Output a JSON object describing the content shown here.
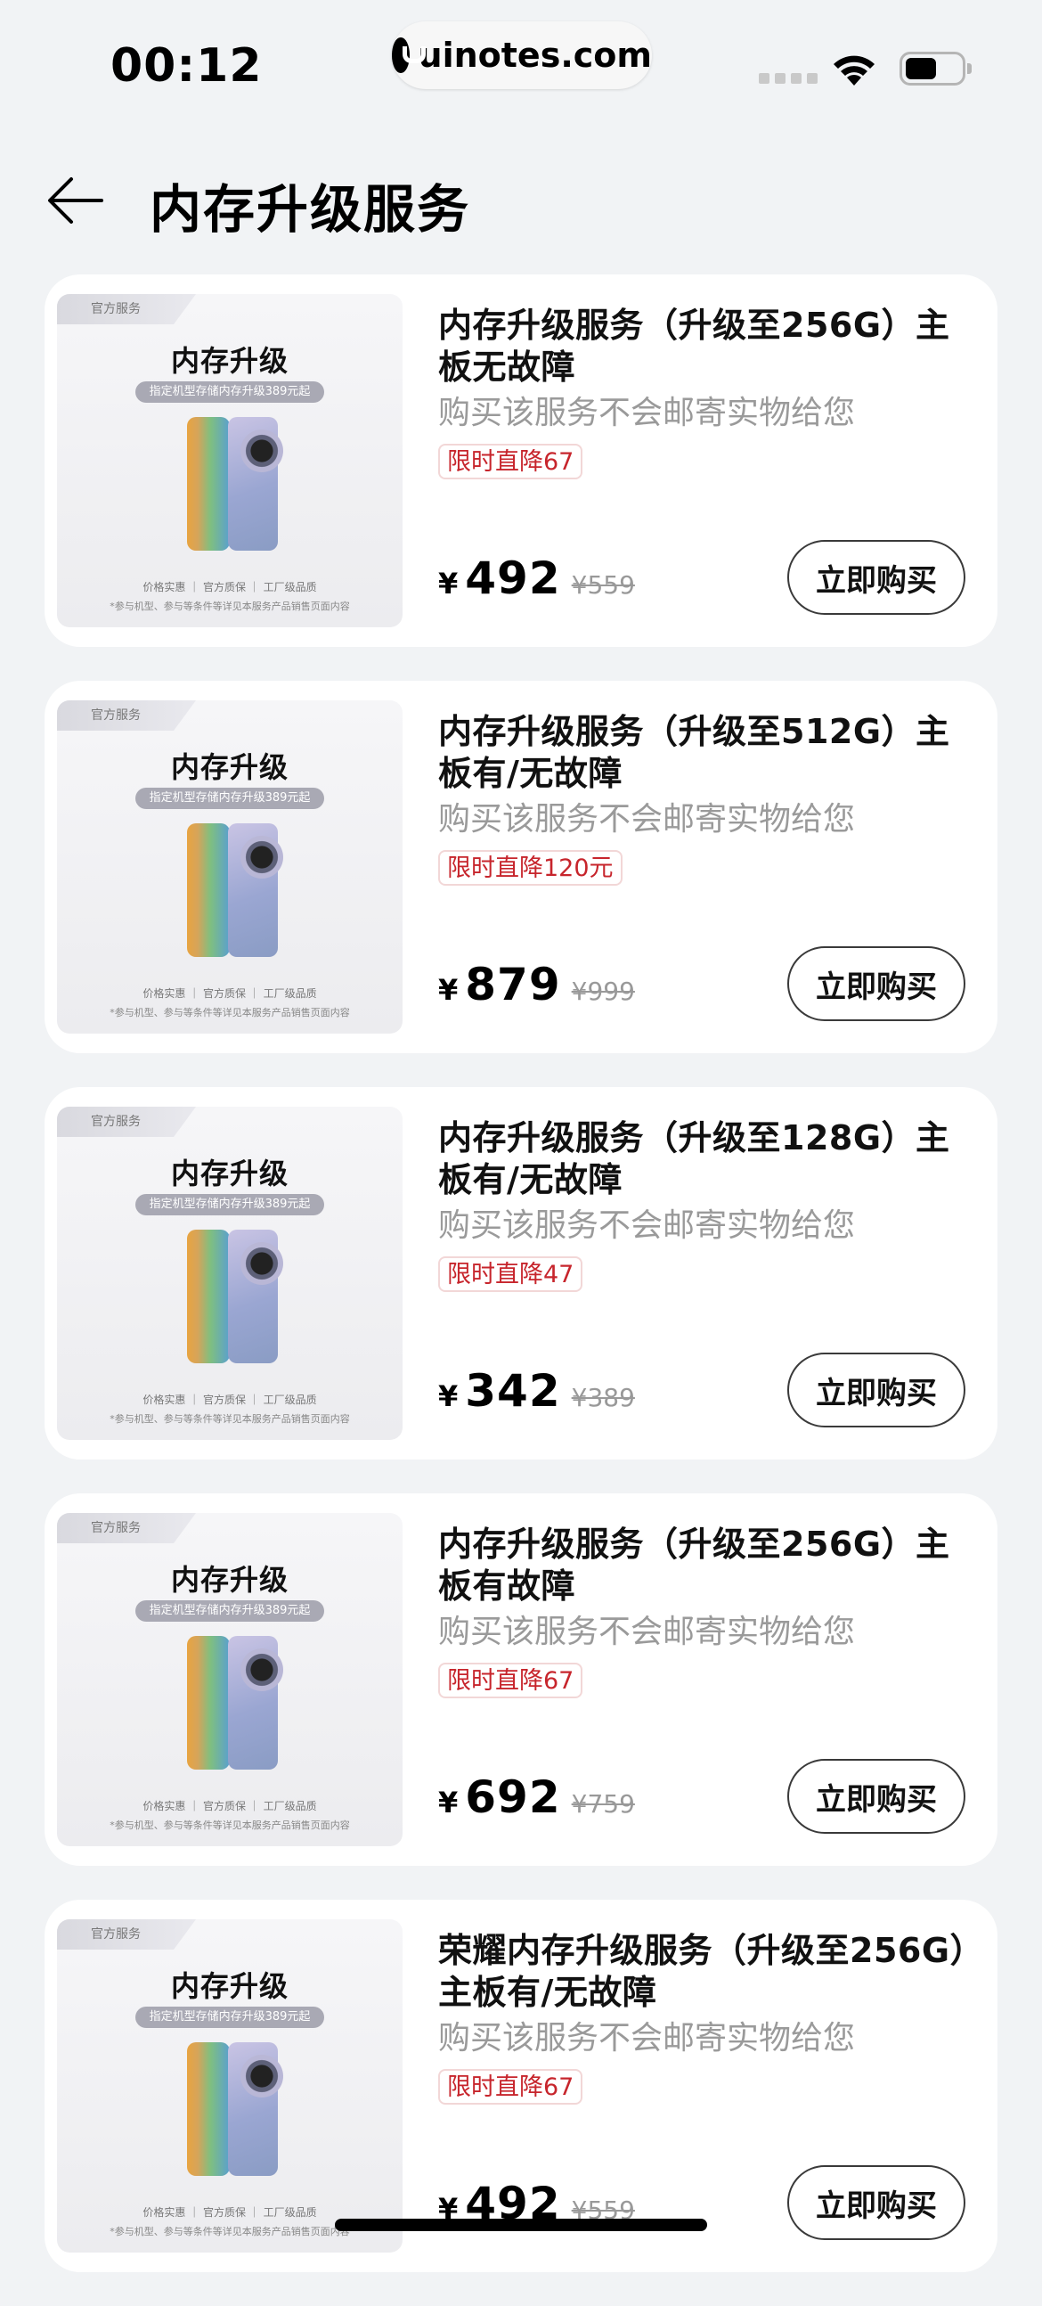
{
  "status_bar": {
    "time": "00:12",
    "url": "uinotes.com"
  },
  "header": {
    "title": "内存升级服务"
  },
  "products": [
    {
      "name": "内存升级服务（升级至256G）主板无故障",
      "desc": "购买该服务不会邮寄实物给您",
      "badge": "限时直降67",
      "yen": "¥",
      "price": "492",
      "original_price": "¥559",
      "button": "立即购买"
    },
    {
      "name": "内存升级服务（升级至512G）主板有/无故障",
      "desc": "购买该服务不会邮寄实物给您",
      "badge": "限时直降120元",
      "yen": "¥",
      "price": "879",
      "original_price": "¥999",
      "button": "立即购买"
    },
    {
      "name": "内存升级服务（升级至128G）主板有/无故障",
      "desc": "购买该服务不会邮寄实物给您",
      "badge": "限时直降47",
      "yen": "¥",
      "price": "342",
      "original_price": "¥389",
      "button": "立即购买"
    },
    {
      "name": "内存升级服务（升级至256G）主板有故障",
      "desc": "购买该服务不会邮寄实物给您",
      "badge": "限时直降67",
      "yen": "¥",
      "price": "692",
      "original_price": "¥759",
      "button": "立即购买"
    },
    {
      "name": "荣耀内存升级服务（升级至256G）主板有/无故障",
      "desc": "购买该服务不会邮寄实物给您",
      "badge": "限时直降67",
      "yen": "¥",
      "price": "492",
      "original_price": "¥559",
      "button": "立即购买"
    }
  ],
  "thumbnail": {
    "tag": "官方服务",
    "title": "内存升级",
    "subtitle": "指定机型存储内存升级389元起",
    "features": "价格实惠 ｜ 官方质保 ｜ 工厂级品质",
    "note": "*参与机型、参与等条件等详见本服务产品销售页面内容"
  },
  "icons": {
    "back": "back-arrow-icon",
    "wifi": "wifi-icon",
    "battery": "battery-icon",
    "signal": "signal-icon",
    "url_logo": "uinotes-logo-icon"
  },
  "colors": {
    "background": "#f1f3f5",
    "card": "#ffffff",
    "badge_text": "#c7252c",
    "muted_text": "#9a9a9a"
  }
}
